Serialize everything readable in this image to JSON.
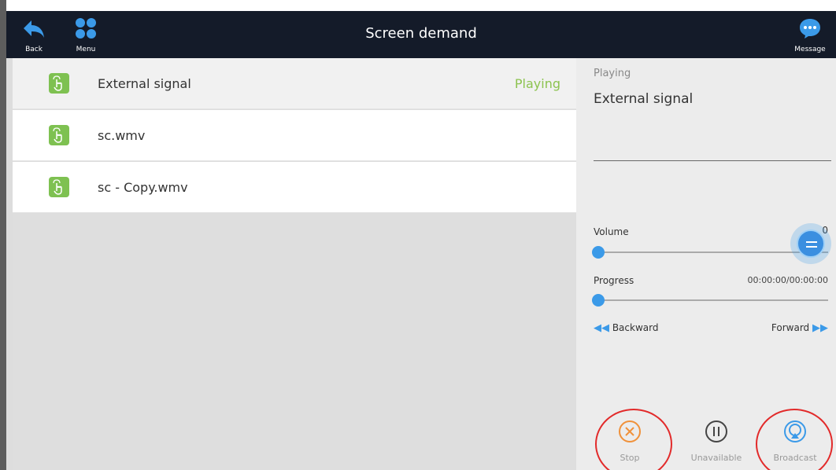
{
  "header": {
    "back_label": "Back",
    "menu_label": "Menu",
    "title": "Screen demand",
    "message_label": "Message"
  },
  "list": {
    "items": [
      {
        "name": "External signal",
        "status": "Playing",
        "active": true
      },
      {
        "name": "sc.wmv",
        "status": "",
        "active": false
      },
      {
        "name": "sc - Copy.wmv",
        "status": "",
        "active": false
      }
    ]
  },
  "panel": {
    "playing_label": "Playing",
    "playing_name": "External signal",
    "volume_label": "Volume",
    "volume_value": "0",
    "progress_label": "Progress",
    "progress_time": "00:00:00/00:00:00",
    "backward_label": "Backward",
    "forward_label": "Forward",
    "stop_label": "Stop",
    "pause_label": "Unavailable",
    "broadcast_label": "Broadcast"
  },
  "colors": {
    "header_bg": "#141b29",
    "accent": "#3b9ae8",
    "item_icon": "#7ec151",
    "playing_status": "#8cc34f",
    "stop_icon": "#f0913a",
    "annotation": "#e22a2a"
  },
  "icons": [
    "back-arrow-icon",
    "menu-grid-icon",
    "message-bubble-icon",
    "touch-hand-icon",
    "rewind-icon",
    "fast-forward-icon",
    "stop-x-icon",
    "pause-icon",
    "broadcast-icon"
  ]
}
